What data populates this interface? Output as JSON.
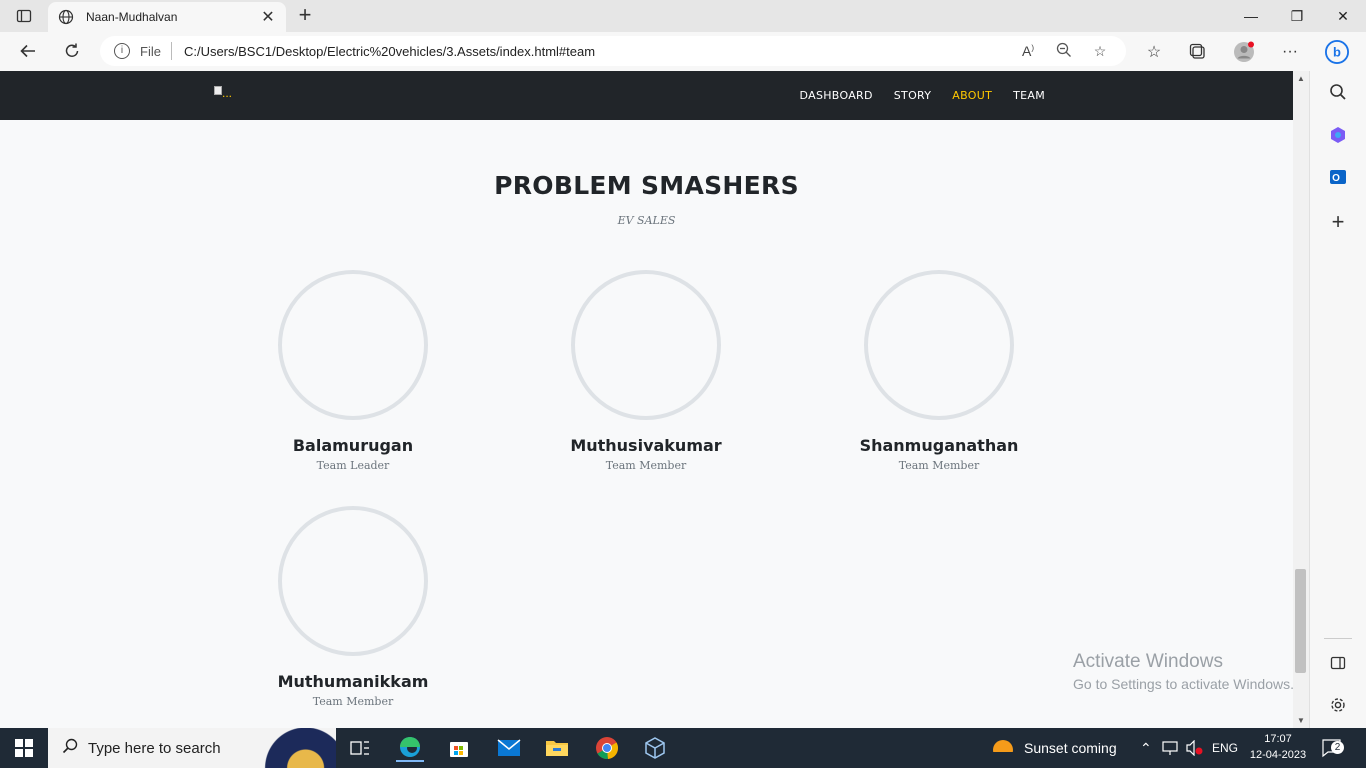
{
  "browser": {
    "tab_title": "Naan-Mudhalvan",
    "scheme_label": "File",
    "url": "C:/Users/BSC1/Desktop/Electric%20vehicles/3.Assets/index.html#team"
  },
  "site": {
    "nav": [
      {
        "label": "DASHBOARD",
        "active": false
      },
      {
        "label": "STORY",
        "active": false
      },
      {
        "label": "ABOUT",
        "active": true
      },
      {
        "label": "TEAM",
        "active": false
      }
    ],
    "brand_alt": "..."
  },
  "team": {
    "heading": "PROBLEM SMASHERS",
    "subheading": "EV SALES",
    "members": [
      {
        "name": "Balamurugan",
        "role": "Team Leader"
      },
      {
        "name": "Muthusivakumar",
        "role": "Team Member"
      },
      {
        "name": "Shanmuganathan",
        "role": "Team Member"
      },
      {
        "name": "Muthumanikkam",
        "role": "Team Member"
      }
    ]
  },
  "watermark": {
    "line1": "Activate Windows",
    "line2": "Go to Settings to activate Windows."
  },
  "taskbar": {
    "search_placeholder": "Type here to search",
    "weather": "Sunset coming",
    "language": "ENG",
    "time": "17:07",
    "date": "12-04-2023",
    "notifications": "2"
  },
  "colors": {
    "accent": "#ffc800",
    "navbar": "#212529",
    "taskbar": "#1f2a36"
  }
}
